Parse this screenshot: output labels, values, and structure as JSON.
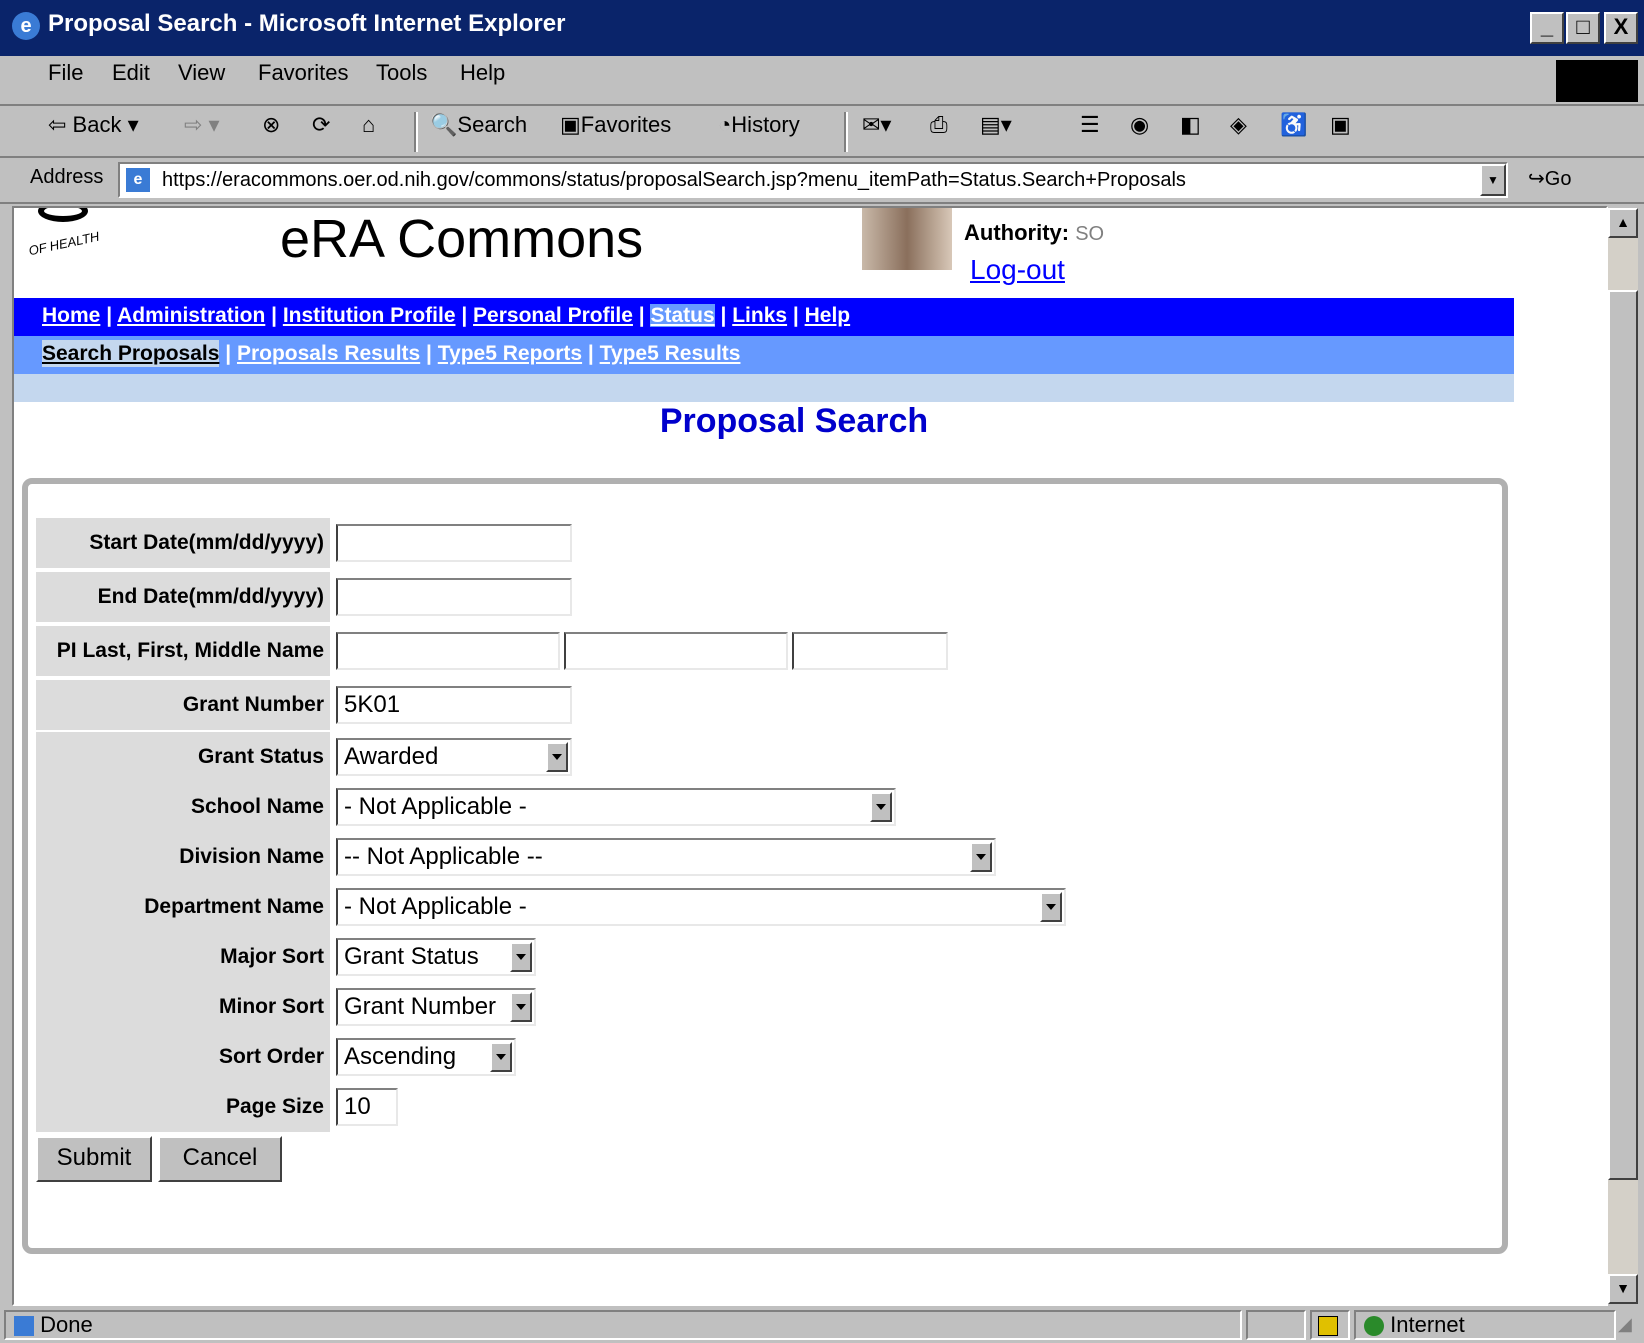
{
  "window": {
    "title": "Proposal Search - Microsoft Internet Explorer",
    "minimize": "_",
    "maximize": "□",
    "close": "X"
  },
  "menu": [
    "File",
    "Edit",
    "View",
    "Favorites",
    "Tools",
    "Help"
  ],
  "toolbar": {
    "back": "Back",
    "search": "Search",
    "favorites": "Favorites",
    "history": "History"
  },
  "address": {
    "label": "Address",
    "url": "https://eracommons.oer.od.nih.gov/commons/status/proposalSearch.jsp?menu_itemPath=Status.Search+Proposals",
    "go": "Go"
  },
  "header": {
    "seal_text": "OF HEALTH",
    "site_title": "eRA Commons",
    "authority_label": "Authority:",
    "authority_value": "SO",
    "logout": "Log-out"
  },
  "nav": {
    "items": [
      "Home",
      "Administration",
      "Institution Profile",
      "Personal Profile",
      "Status",
      "Links",
      "Help"
    ],
    "active": "Status",
    "color": "#0000ff"
  },
  "subnav": {
    "items": [
      "Search Proposals",
      "Proposals Results",
      "Type5 Reports",
      "Type5 Results"
    ],
    "active": "Search Proposals",
    "color": "#6699ff"
  },
  "page_title": "Proposal Search",
  "form": {
    "start_date": {
      "label": "Start Date(mm/dd/yyyy)",
      "value": ""
    },
    "end_date": {
      "label": "End Date(mm/dd/yyyy)",
      "value": ""
    },
    "pi_name": {
      "label": "PI Last, First, Middle Name",
      "last": "",
      "first": "",
      "middle": ""
    },
    "grant_number": {
      "label": "Grant Number",
      "value": "5K01"
    },
    "grant_status": {
      "label": "Grant Status",
      "value": "Awarded"
    },
    "school_name": {
      "label": "School Name",
      "value": "- Not Applicable -"
    },
    "division_name": {
      "label": "Division Name",
      "value": "-- Not Applicable --"
    },
    "department_name": {
      "label": "Department Name",
      "value": "- Not Applicable -"
    },
    "major_sort": {
      "label": "Major Sort",
      "value": "Grant Status"
    },
    "minor_sort": {
      "label": "Minor Sort",
      "value": "Grant Number"
    },
    "sort_order": {
      "label": "Sort Order",
      "value": "Ascending"
    },
    "page_size": {
      "label": "Page Size",
      "value": "10"
    },
    "submit": "Submit",
    "cancel": "Cancel"
  },
  "status": {
    "text": "Done",
    "zone": "Internet"
  }
}
